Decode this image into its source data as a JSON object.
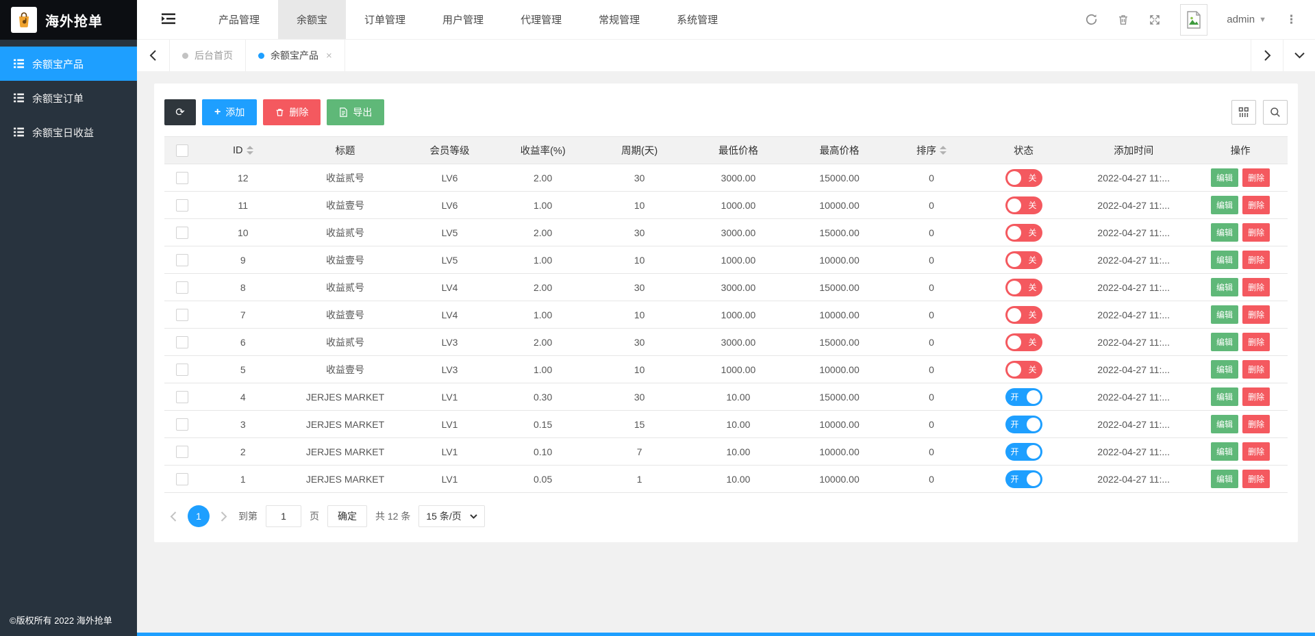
{
  "colors": {
    "accent": "#1E9FFF",
    "green": "#5FB878",
    "red": "#f4595f",
    "dark": "#2F363C",
    "sidebar_bg": "#28333E",
    "logo_bg": "#0c0e12"
  },
  "sidebar": {
    "logo_title": "海外抢单",
    "items": [
      {
        "label": "余额宝产品",
        "active": true
      },
      {
        "label": "余额宝订单",
        "active": false
      },
      {
        "label": "余额宝日收益",
        "active": false
      }
    ],
    "footer": "©版权所有 2022 海外抢单"
  },
  "topnav": {
    "items": [
      {
        "label": "产品管理",
        "active": false
      },
      {
        "label": "余额宝",
        "active": true
      },
      {
        "label": "订单管理",
        "active": false
      },
      {
        "label": "用户管理",
        "active": false
      },
      {
        "label": "代理管理",
        "active": false
      },
      {
        "label": "常规管理",
        "active": false
      },
      {
        "label": "系统管理",
        "active": false
      }
    ],
    "username": "admin"
  },
  "tabs": [
    {
      "label": "后台首页",
      "active": false,
      "closable": false
    },
    {
      "label": "余额宝产品",
      "active": true,
      "closable": true
    }
  ],
  "toolbar": {
    "add_label": "添加",
    "delete_label": "删除",
    "export_label": "导出"
  },
  "table": {
    "columns": [
      {
        "label": "ID",
        "sortable": true
      },
      {
        "label": "标题",
        "sortable": false
      },
      {
        "label": "会员等级",
        "sortable": false
      },
      {
        "label": "收益率(%)",
        "sortable": false
      },
      {
        "label": "周期(天)",
        "sortable": false
      },
      {
        "label": "最低价格",
        "sortable": false
      },
      {
        "label": "最高价格",
        "sortable": false
      },
      {
        "label": "排序",
        "sortable": true
      },
      {
        "label": "状态",
        "sortable": false
      },
      {
        "label": "添加时间",
        "sortable": false
      },
      {
        "label": "操作",
        "sortable": false
      }
    ],
    "status_on": "开",
    "status_off": "关",
    "action_edit": "编辑",
    "action_delete": "删除",
    "rows": [
      {
        "id": "12",
        "title": "收益贰号",
        "level": "LV6",
        "rate": "2.00",
        "period": "30",
        "min": "3000.00",
        "max": "15000.00",
        "sort": "0",
        "on": false,
        "time": "2022-04-27 11:..."
      },
      {
        "id": "11",
        "title": "收益壹号",
        "level": "LV6",
        "rate": "1.00",
        "period": "10",
        "min": "1000.00",
        "max": "10000.00",
        "sort": "0",
        "on": false,
        "time": "2022-04-27 11:..."
      },
      {
        "id": "10",
        "title": "收益贰号",
        "level": "LV5",
        "rate": "2.00",
        "period": "30",
        "min": "3000.00",
        "max": "15000.00",
        "sort": "0",
        "on": false,
        "time": "2022-04-27 11:..."
      },
      {
        "id": "9",
        "title": "收益壹号",
        "level": "LV5",
        "rate": "1.00",
        "period": "10",
        "min": "1000.00",
        "max": "10000.00",
        "sort": "0",
        "on": false,
        "time": "2022-04-27 11:..."
      },
      {
        "id": "8",
        "title": "收益贰号",
        "level": "LV4",
        "rate": "2.00",
        "period": "30",
        "min": "3000.00",
        "max": "15000.00",
        "sort": "0",
        "on": false,
        "time": "2022-04-27 11:..."
      },
      {
        "id": "7",
        "title": "收益壹号",
        "level": "LV4",
        "rate": "1.00",
        "period": "10",
        "min": "1000.00",
        "max": "10000.00",
        "sort": "0",
        "on": false,
        "time": "2022-04-27 11:..."
      },
      {
        "id": "6",
        "title": "收益贰号",
        "level": "LV3",
        "rate": "2.00",
        "period": "30",
        "min": "3000.00",
        "max": "15000.00",
        "sort": "0",
        "on": false,
        "time": "2022-04-27 11:..."
      },
      {
        "id": "5",
        "title": "收益壹号",
        "level": "LV3",
        "rate": "1.00",
        "period": "10",
        "min": "1000.00",
        "max": "10000.00",
        "sort": "0",
        "on": false,
        "time": "2022-04-27 11:..."
      },
      {
        "id": "4",
        "title": "JERJES MARKET",
        "level": "LV1",
        "rate": "0.30",
        "period": "30",
        "min": "10.00",
        "max": "15000.00",
        "sort": "0",
        "on": true,
        "time": "2022-04-27 11:..."
      },
      {
        "id": "3",
        "title": "JERJES MARKET",
        "level": "LV1",
        "rate": "0.15",
        "period": "15",
        "min": "10.00",
        "max": "10000.00",
        "sort": "0",
        "on": true,
        "time": "2022-04-27 11:..."
      },
      {
        "id": "2",
        "title": "JERJES MARKET",
        "level": "LV1",
        "rate": "0.10",
        "period": "7",
        "min": "10.00",
        "max": "10000.00",
        "sort": "0",
        "on": true,
        "time": "2022-04-27 11:..."
      },
      {
        "id": "1",
        "title": "JERJES MARKET",
        "level": "LV1",
        "rate": "0.05",
        "period": "1",
        "min": "10.00",
        "max": "10000.00",
        "sort": "0",
        "on": true,
        "time": "2022-04-27 11:..."
      }
    ]
  },
  "pagination": {
    "current_page": "1",
    "goto_prefix": "到第",
    "goto_value": "1",
    "goto_suffix": "页",
    "confirm_label": "确定",
    "total_label": "共 12 条",
    "page_size_label": "15 条/页"
  }
}
